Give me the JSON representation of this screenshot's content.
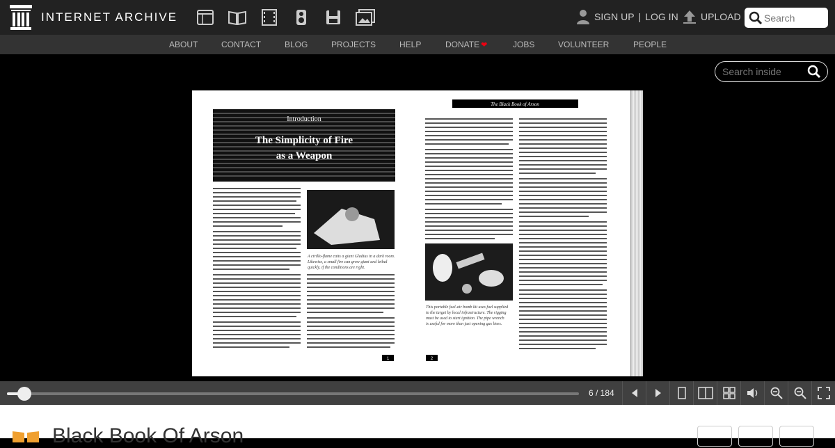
{
  "header": {
    "logo_text": "INTERNET ARCHIVE",
    "media_icons": [
      "web-icon",
      "texts-icon",
      "video-icon",
      "audio-icon",
      "software-icon",
      "images-icon"
    ],
    "signup": "SIGN UP",
    "separator": "|",
    "login": "LOG IN",
    "upload": "UPLOAD",
    "search_placeholder": "Search"
  },
  "subnav": {
    "items": [
      "ABOUT",
      "CONTACT",
      "BLOG",
      "PROJECTS",
      "HELP",
      "DONATE",
      "JOBS",
      "VOLUNTEER",
      "PEOPLE"
    ]
  },
  "reader": {
    "search_inside_placeholder": "Search inside",
    "left_page": {
      "chapter_label": "Introduction",
      "chapter_title": "The Simplicity of Fire as a Weapon",
      "caption": "A cirillo-flame caits a giant Gladius in a dark room. Likewise, a small fire can grow giant and lethal quickly, if the conditions are right.",
      "page_number": "1"
    },
    "right_page": {
      "running_head": "The Black Book of Arson",
      "caption": "This portable fuel-air bomb kit uses fuel supplied to the target by local infrastructure. The rigging must be used to start ignition. The pipe wrench is useful for more than just opening gas lines.",
      "page_number": "2"
    },
    "page_indicator": "6 / 184",
    "progress": 0.03
  },
  "controls": [
    "prev-icon",
    "next-icon",
    "one-page-icon",
    "two-page-icon",
    "thumbnails-icon",
    "read-aloud-icon",
    "zoom-out-icon",
    "zoom-in-icon",
    "fullscreen-icon"
  ],
  "item": {
    "title": "Black Book Of Arson"
  },
  "colors": {
    "topbar": "#222222",
    "subnav": "#333333",
    "accent_heart": "#ee1111",
    "texts_icon": "#f0a030"
  }
}
